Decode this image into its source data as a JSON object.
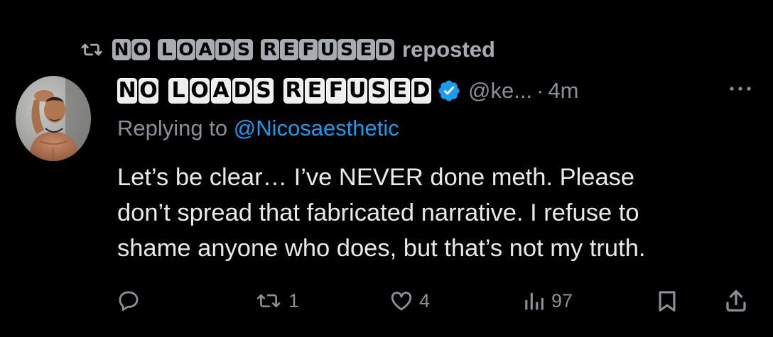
{
  "repost": {
    "icon": "repost-icon",
    "display_name_letters": [
      "N",
      "O",
      " ",
      "L",
      "O",
      "A",
      "D",
      "S",
      " ",
      "R",
      "E",
      "F",
      "U",
      "S",
      "E",
      "D"
    ],
    "label": "reposted"
  },
  "author": {
    "avatar": "avatar-photo",
    "display_name_letters": [
      "N",
      "O",
      " ",
      "L",
      "O",
      "A",
      "D",
      "S",
      " ",
      "R",
      "E",
      "F",
      "U",
      "S",
      "E",
      "D"
    ],
    "verified_icon": "verified-badge-icon",
    "handle": "@ke...",
    "separator": "·",
    "time": "4m",
    "more_icon": "more-options-icon"
  },
  "reply": {
    "prefix": "Replying to",
    "mention": "@Nicosaesthetic"
  },
  "body": {
    "lines": [
      "Let’s be clear… I’ve NEVER done meth. Please",
      "don’t spread that fabricated narrative. I refuse to",
      "shame anyone who does, but that’s not my truth."
    ]
  },
  "actions": {
    "reply": {
      "icon": "reply-icon",
      "count": ""
    },
    "repost": {
      "icon": "repost-icon",
      "count": "1"
    },
    "like": {
      "icon": "heart-icon",
      "count": "4"
    },
    "views": {
      "icon": "views-icon",
      "count": "97"
    },
    "bookmark": {
      "icon": "bookmark-icon",
      "count": ""
    },
    "share": {
      "icon": "share-icon",
      "count": ""
    }
  },
  "colors": {
    "background": "#000000",
    "text": "#e7e9ea",
    "secondary": "#8b9096",
    "link": "#1d9bf0",
    "verified": "#1d9bf0"
  }
}
